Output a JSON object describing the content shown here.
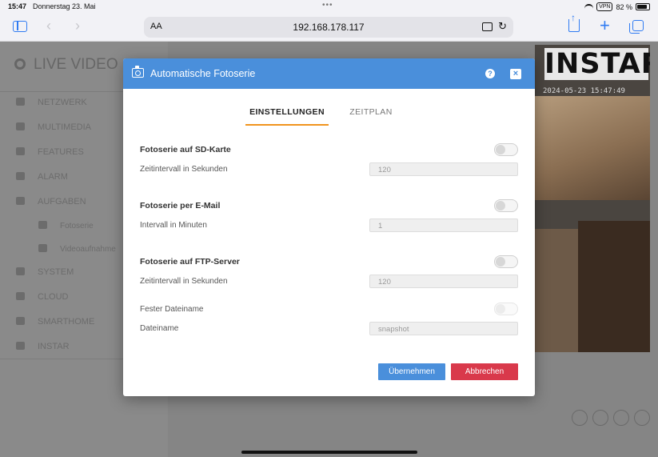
{
  "status_bar": {
    "time": "15:47",
    "date": "Donnerstag 23. Mai",
    "vpn": "VPN",
    "battery": "82 %"
  },
  "browser": {
    "reader_label": "AA",
    "url": "192.168.178.117"
  },
  "background": {
    "page_title": "LIVE VIDEO",
    "nav_items": [
      "NETZWERK",
      "MULTIMEDIA",
      "FEATURES",
      "ALARM",
      "AUFGABEN",
      "Fotoserie",
      "Videoaufnahme",
      "SYSTEM",
      "CLOUD",
      "SMARTHOME",
      "INSTAR"
    ],
    "logo": "INSTAR",
    "timestamp": "2024-05-23 15:47:49"
  },
  "modal": {
    "title": "Automatische Fotoserie",
    "help_label": "?",
    "close_label": "×",
    "tabs": [
      {
        "label": "EINSTELLUNGEN",
        "active": true
      },
      {
        "label": "ZEITPLAN",
        "active": false
      }
    ],
    "sd": {
      "label": "Fotoserie auf SD-Karte",
      "enabled": false,
      "interval_label": "Zeitintervall in Sekunden",
      "interval_value": "120"
    },
    "email": {
      "label": "Fotoserie per E-Mail",
      "enabled": false,
      "interval_label": "Intervall in Minuten",
      "interval_value": "1"
    },
    "ftp": {
      "label": "Fotoserie auf FTP-Server",
      "enabled": false,
      "interval_label": "Zeitintervall in Sekunden",
      "interval_value": "120",
      "fixed_name_label": "Fester Dateiname",
      "fixed_name_enabled": false,
      "filename_label": "Dateiname",
      "filename_value": "snapshot"
    },
    "buttons": {
      "apply": "Übernehmen",
      "cancel": "Abbrechen"
    },
    "colors": {
      "header": "#4a8fdb",
      "tab_accent": "#f0941e",
      "apply": "#4a8fdb",
      "cancel": "#d9394b"
    }
  }
}
